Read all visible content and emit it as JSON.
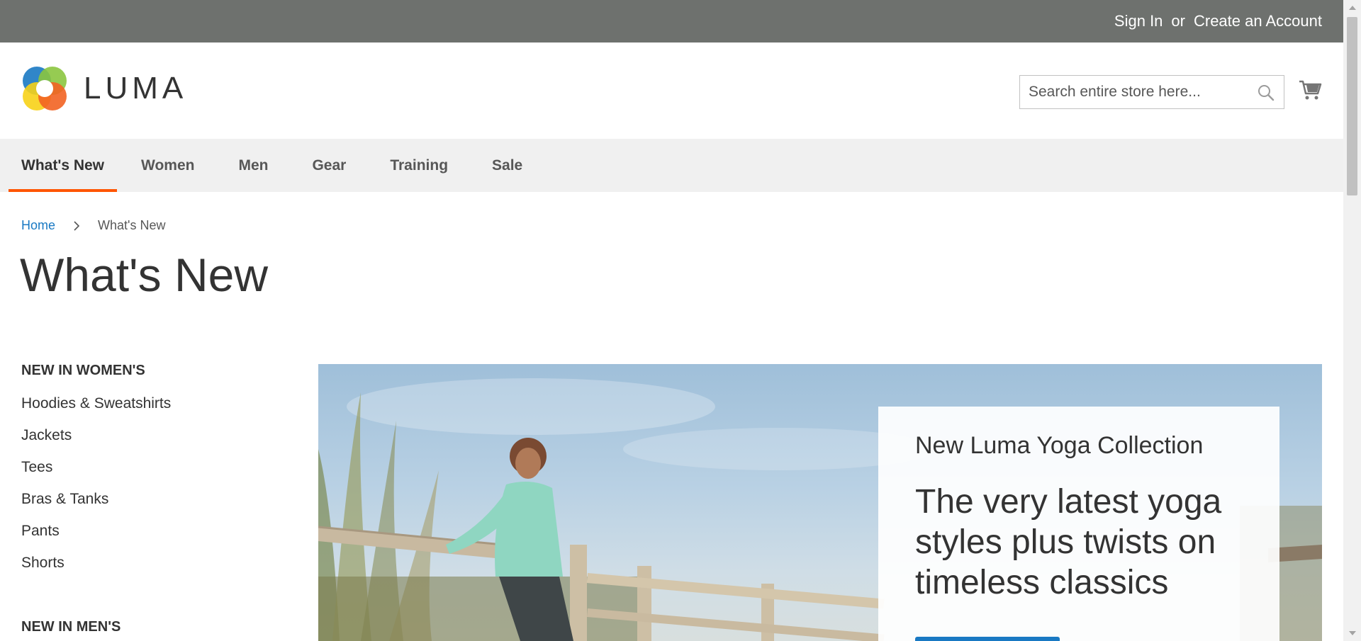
{
  "top_links": {
    "sign_in": "Sign In",
    "or": "or",
    "create_account": "Create an Account"
  },
  "header": {
    "logo_text": "LUMA",
    "search_placeholder": "Search entire store here...",
    "search_icon": "search-icon",
    "cart_icon": "cart-icon"
  },
  "nav": {
    "items": [
      {
        "label": "What's New",
        "active": true
      },
      {
        "label": "Women"
      },
      {
        "label": "Men"
      },
      {
        "label": "Gear"
      },
      {
        "label": "Training"
      },
      {
        "label": "Sale"
      }
    ]
  },
  "breadcrumb": {
    "home": "Home",
    "current": "What's New"
  },
  "page_title": "What's New",
  "sidebar": {
    "women_heading": "NEW IN WOMEN'S",
    "women_items": [
      "Hoodies & Sweatshirts",
      "Jackets",
      "Tees",
      "Bras & Tanks",
      "Pants",
      "Shorts"
    ],
    "men_heading": "NEW IN MEN'S"
  },
  "hero": {
    "subtitle": "New Luma Yoga Collection",
    "headline": "The very latest yoga styles plus twists on timeless classics"
  },
  "colors": {
    "top_bar": "#6e716e",
    "nav_active_underline": "#ff5501",
    "link": "#1979c3",
    "button": "#1979c3"
  }
}
